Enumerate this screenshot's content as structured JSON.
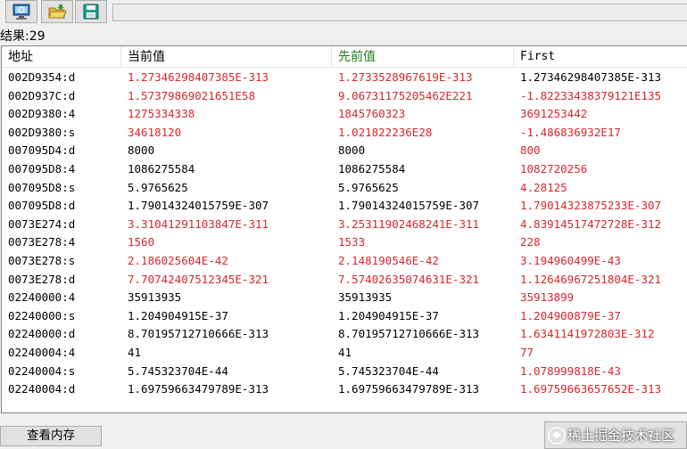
{
  "toolbar": {
    "buttons": [
      {
        "icon": "monitor-search-icon"
      },
      {
        "icon": "open-folder-icon"
      },
      {
        "icon": "save-disk-icon"
      }
    ],
    "address_value": ""
  },
  "result_label": "结果:29",
  "table": {
    "columns": [
      "地址",
      "当前值",
      "先前值",
      "First"
    ],
    "rows": [
      {
        "addr": "002D9354:d",
        "cur": "1.27346298407385E-313",
        "prev": "1.2733528967619E-313",
        "first": "1.27346298407385E-313",
        "cur_red": true,
        "prev_red": true,
        "first_red": false
      },
      {
        "addr": "002D937C:d",
        "cur": "1.57379869021651E58",
        "prev": "9.06731175205462E221",
        "first": "-1.82233438379121E135",
        "cur_red": true,
        "prev_red": true,
        "first_red": true
      },
      {
        "addr": "002D9380:4",
        "cur": "1275334338",
        "prev": "1845760323",
        "first": "3691253442",
        "cur_red": true,
        "prev_red": true,
        "first_red": true
      },
      {
        "addr": "002D9380:s",
        "cur": "34618120",
        "prev": "1.021822236E28",
        "first": "-1.486836932E17",
        "cur_red": true,
        "prev_red": true,
        "first_red": true
      },
      {
        "addr": "007095D4:d",
        "cur": "8000",
        "prev": "8000",
        "first": "800",
        "cur_red": false,
        "prev_red": false,
        "first_red": true
      },
      {
        "addr": "007095D8:4",
        "cur": "1086275584",
        "prev": "1086275584",
        "first": "1082720256",
        "cur_red": false,
        "prev_red": false,
        "first_red": true
      },
      {
        "addr": "007095D8:s",
        "cur": "5.9765625",
        "prev": "5.9765625",
        "first": "4.28125",
        "cur_red": false,
        "prev_red": false,
        "first_red": true
      },
      {
        "addr": "007095D8:d",
        "cur": "1.79014324015759E-307",
        "prev": "1.79014324015759E-307",
        "first": "1.79014323875233E-307",
        "cur_red": false,
        "prev_red": false,
        "first_red": true
      },
      {
        "addr": "0073E274:d",
        "cur": "3.31041291103847E-311",
        "prev": "3.25311902468241E-311",
        "first": "4.83914517472728E-312",
        "cur_red": true,
        "prev_red": true,
        "first_red": true
      },
      {
        "addr": "0073E278:4",
        "cur": "1560",
        "prev": "1533",
        "first": "228",
        "cur_red": true,
        "prev_red": true,
        "first_red": true
      },
      {
        "addr": "0073E278:s",
        "cur": "2.186025604E-42",
        "prev": "2.148190546E-42",
        "first": "3.194960499E-43",
        "cur_red": true,
        "prev_red": true,
        "first_red": true
      },
      {
        "addr": "0073E278:d",
        "cur": "7.70742407512345E-321",
        "prev": "7.57402635074631E-321",
        "first": "1.12646967251804E-321",
        "cur_red": true,
        "prev_red": true,
        "first_red": true
      },
      {
        "addr": "02240000:4",
        "cur": "35913935",
        "prev": "35913935",
        "first": "35913899",
        "cur_red": false,
        "prev_red": false,
        "first_red": true
      },
      {
        "addr": "02240000:s",
        "cur": "1.204904915E-37",
        "prev": "1.204904915E-37",
        "first": "1.204900879E-37",
        "cur_red": false,
        "prev_red": false,
        "first_red": true
      },
      {
        "addr": "02240000:d",
        "cur": "8.70195712710666E-313",
        "prev": "8.70195712710666E-313",
        "first": "1.6341141972803E-312",
        "cur_red": false,
        "prev_red": false,
        "first_red": true
      },
      {
        "addr": "02240004:4",
        "cur": "41",
        "prev": "41",
        "first": "77",
        "cur_red": false,
        "prev_red": false,
        "first_red": true
      },
      {
        "addr": "02240004:s",
        "cur": "5.745323704E-44",
        "prev": "5.745323704E-44",
        "first": "1.078999818E-43",
        "cur_red": false,
        "prev_red": false,
        "first_red": true
      },
      {
        "addr": "02240004:d",
        "cur": "1.69759663479789E-313",
        "prev": "1.69759663479789E-313",
        "first": "1.69759663657652E-313",
        "cur_red": false,
        "prev_red": false,
        "first_red": true
      }
    ]
  },
  "view_memory_button": "查看内存",
  "watermark": "稀土掘金技术社区",
  "colors": {
    "changed": "#d8262b",
    "prev_header": "#1d7a1d"
  }
}
